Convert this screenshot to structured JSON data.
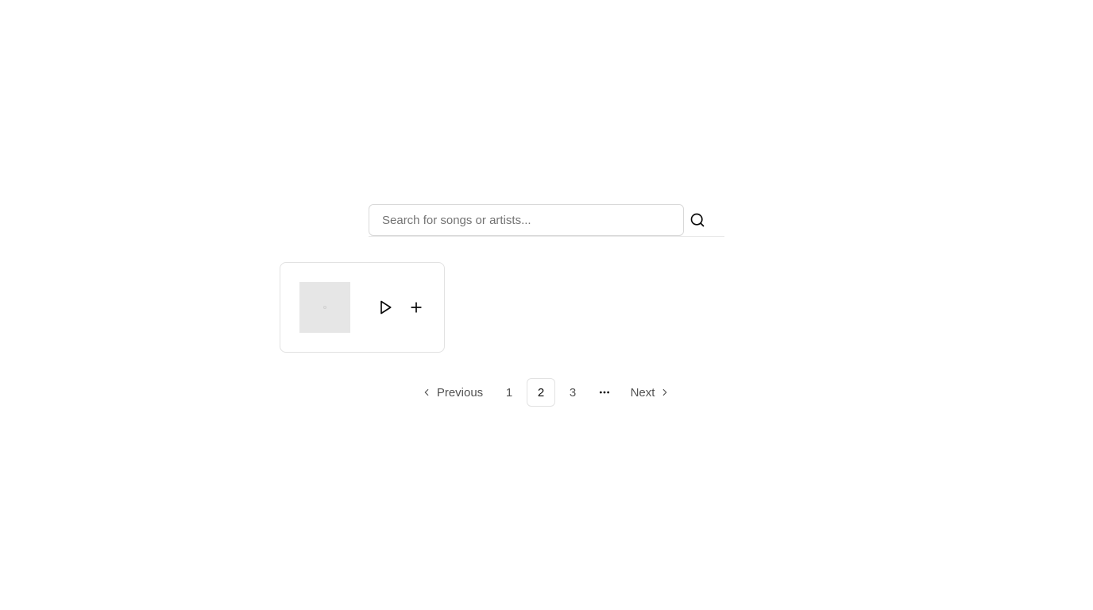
{
  "search": {
    "placeholder": "Search for songs or artists...",
    "value": "",
    "icon": "search-icon"
  },
  "results": [
    {
      "thumbnail_icon": "album-placeholder-icon",
      "actions": [
        "play-icon",
        "plus-icon"
      ]
    }
  ],
  "pagination": {
    "previous_label": "Previous",
    "next_label": "Next",
    "pages": [
      "1",
      "2",
      "3"
    ],
    "current_page": "2",
    "ellipsis_icon": "more-horizontal-icon"
  }
}
